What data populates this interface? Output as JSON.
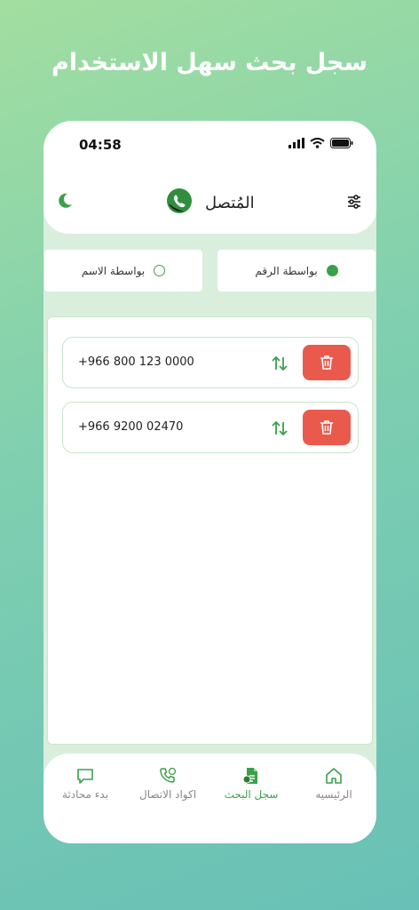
{
  "hero": {
    "title": "سجل بحث سهل الاستخدام"
  },
  "status_bar": {
    "time": "04:58"
  },
  "app": {
    "title": "المُتصل"
  },
  "search_mode": {
    "by_number": "بواسطة الرقم",
    "by_name": "بواسطة الاسم",
    "selected": "by_number"
  },
  "history": [
    {
      "phone": "+966 800 123 0000"
    },
    {
      "phone": "+966 9200 02470"
    }
  ],
  "nav": {
    "home": "الرئيسيه",
    "history": "سجل البحث",
    "codes": "اكواد الاتصال",
    "chat": "بدء محادثة",
    "active": "history"
  },
  "colors": {
    "accent": "#3aa14a",
    "delete": "#ea5a4c",
    "background": "#d9eedd"
  }
}
